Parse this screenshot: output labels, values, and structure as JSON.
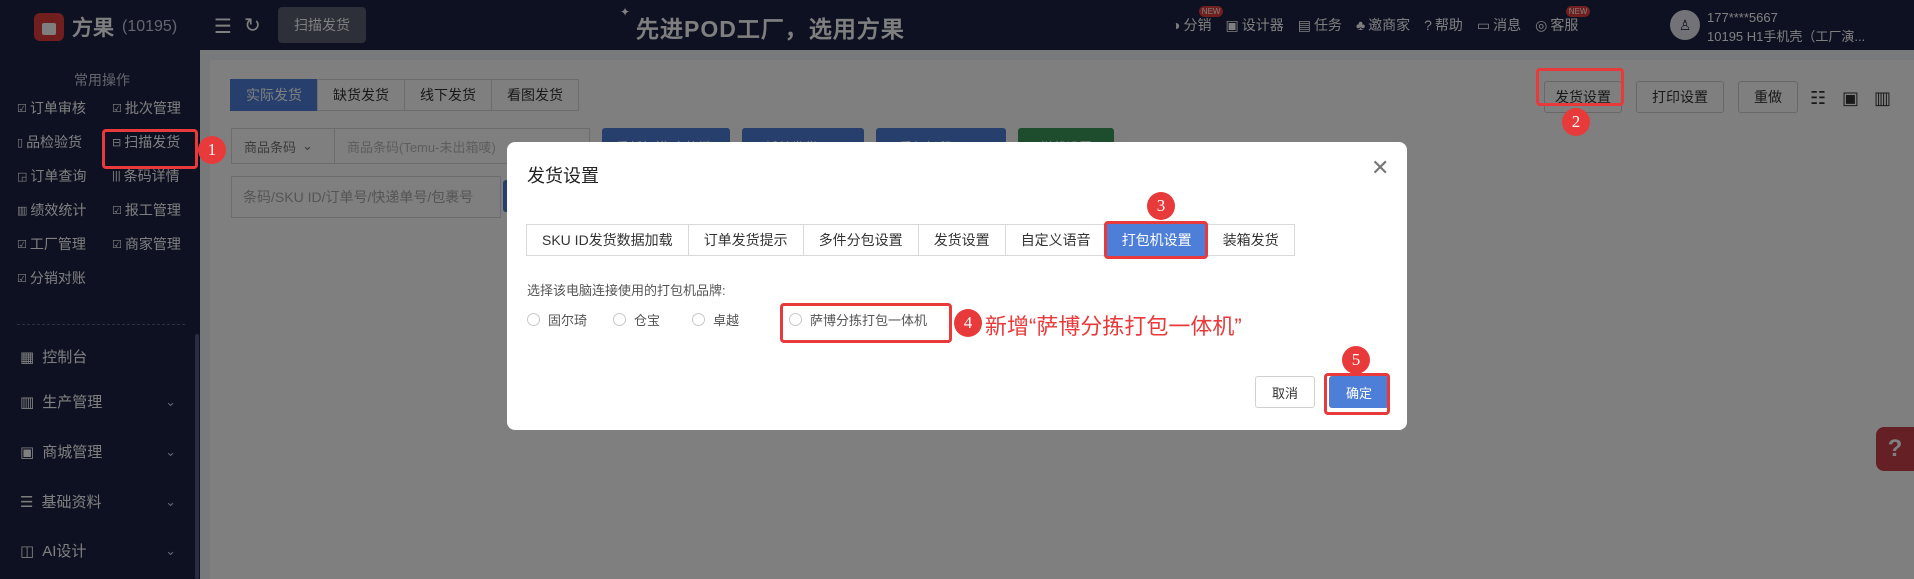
{
  "topbar": {
    "logo_name": "方果",
    "logo_count": "(10195)",
    "scan_button": "扫描发货",
    "slogan": "先进POD工厂，选用方果",
    "nav": [
      {
        "icon": "share-icon",
        "glyph": "◑",
        "label": "分销",
        "badge": "NEW"
      },
      {
        "icon": "image-icon",
        "glyph": "▣",
        "label": "设计器",
        "badge": ""
      },
      {
        "icon": "task-icon",
        "glyph": "▤",
        "label": "任务",
        "badge": ""
      },
      {
        "icon": "invite-icon",
        "glyph": "♣",
        "label": "邀商家",
        "badge": ""
      },
      {
        "icon": "help-icon",
        "glyph": "?",
        "label": "帮助",
        "badge": ""
      },
      {
        "icon": "message-icon",
        "glyph": "▭",
        "label": "消息",
        "badge": ""
      },
      {
        "icon": "service-icon",
        "glyph": "◎",
        "label": "客服",
        "badge": "NEW"
      }
    ],
    "user_phone": "177****5667",
    "user_store": "10195  H1手机壳（工厂演..."
  },
  "sidebar": {
    "section_title": "常用操作",
    "quick_actions": [
      {
        "label": "订单审核",
        "icon": "check-icon"
      },
      {
        "label": "批次管理",
        "icon": "check-icon"
      },
      {
        "label": "品检验货",
        "icon": "inspect-icon"
      },
      {
        "label": "扫描发货",
        "icon": "scan-icon"
      },
      {
        "label": "订单查询",
        "icon": "search-icon"
      },
      {
        "label": "条码详情",
        "icon": "barcode-icon"
      },
      {
        "label": "绩效统计",
        "icon": "chart-icon"
      },
      {
        "label": "报工管理",
        "icon": "check-icon"
      },
      {
        "label": "工厂管理",
        "icon": "check-icon"
      },
      {
        "label": "商家管理",
        "icon": "check-icon"
      },
      {
        "label": "分销对账",
        "icon": "check-icon"
      }
    ],
    "menu": [
      {
        "label": "控制台",
        "glyph": "▦"
      },
      {
        "label": "生产管理",
        "glyph": "▥"
      },
      {
        "label": "商城管理",
        "glyph": "▣"
      },
      {
        "label": "基础资料",
        "glyph": "☰"
      },
      {
        "label": "AI设计",
        "glyph": "◫"
      }
    ]
  },
  "main": {
    "tabs": [
      "实际发货",
      "缺货发货",
      "线下发货",
      "看图发货"
    ],
    "active_tab": 0,
    "tools": [
      "发货设置",
      "打印设置",
      "重做"
    ],
    "filter_select": "商品条码",
    "filter_placeholder": "商品条码(Temu-未出箱唛)",
    "actions": [
      {
        "label": "重新扫描(空格键)",
        "color": "#4e7fd8"
      },
      {
        "label": "拆单发货(F7)",
        "color": "#4e7fd8"
      },
      {
        "label": "重复打印(F10)",
        "color": "#4e7fd8"
      },
      {
        "label": "拦截设置",
        "color": "#3a9a58"
      }
    ],
    "barcode_placeholder": "条码/SKU ID/订单号/快递单号/包裹号"
  },
  "modal": {
    "title": "发货设置",
    "tabs": [
      "SKU ID发货数据加载",
      "订单发货提示",
      "多件分包设置",
      "发货设置",
      "自定义语音",
      "打包机设置",
      "装箱发货"
    ],
    "active_tab": 5,
    "label": "选择该电脑连接使用的打包机品牌:",
    "brands": [
      "固尔琦",
      "仓宝",
      "卓越",
      "萨博分拣打包一体机"
    ],
    "cancel": "取消",
    "ok": "确定"
  },
  "annotations": {
    "steps": [
      "1",
      "2",
      "3",
      "4",
      "5"
    ],
    "note": "新增“萨博分拣打包一体机”",
    "color": "#e83a3a"
  }
}
